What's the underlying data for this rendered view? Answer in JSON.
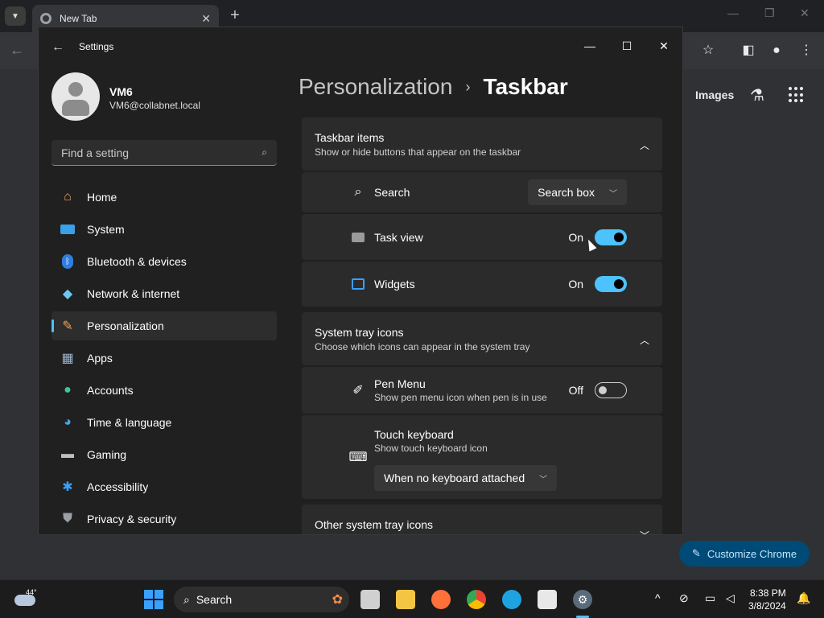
{
  "chrome": {
    "tab_title": "New Tab",
    "images_link": "Images",
    "customize_label": "Customize Chrome"
  },
  "settings": {
    "window_title": "Settings",
    "user": {
      "name": "VM6",
      "email": "VM6@collabnet.local"
    },
    "search_placeholder": "Find a setting",
    "nav": [
      {
        "label": "Home",
        "icon": "home-icon"
      },
      {
        "label": "System",
        "icon": "system-icon"
      },
      {
        "label": "Bluetooth & devices",
        "icon": "bluetooth-icon"
      },
      {
        "label": "Network & internet",
        "icon": "network-icon"
      },
      {
        "label": "Personalization",
        "icon": "brush-icon",
        "active": true
      },
      {
        "label": "Apps",
        "icon": "apps-icon"
      },
      {
        "label": "Accounts",
        "icon": "accounts-icon"
      },
      {
        "label": "Time & language",
        "icon": "globe-icon"
      },
      {
        "label": "Gaming",
        "icon": "gamepad-icon"
      },
      {
        "label": "Accessibility",
        "icon": "accessibility-icon"
      },
      {
        "label": "Privacy & security",
        "icon": "shield-icon"
      }
    ],
    "breadcrumb": {
      "parent": "Personalization",
      "current": "Taskbar"
    },
    "taskbar_items": {
      "title": "Taskbar items",
      "subtitle": "Show or hide buttons that appear on the taskbar",
      "search": {
        "label": "Search",
        "value": "Search box"
      },
      "task_view": {
        "label": "Task view",
        "state": "On"
      },
      "widgets": {
        "label": "Widgets",
        "state": "On"
      }
    },
    "system_tray": {
      "title": "System tray icons",
      "subtitle": "Choose which icons can appear in the system tray",
      "pen_menu": {
        "label": "Pen Menu",
        "sub": "Show pen menu icon when pen is in use",
        "state": "Off"
      },
      "touch_keyboard": {
        "label": "Touch keyboard",
        "sub": "Show touch keyboard icon",
        "value": "When no keyboard attached"
      }
    },
    "other_tray": {
      "title": "Other system tray icons"
    }
  },
  "taskbar": {
    "temperature": "44°",
    "search_label": "Search",
    "time": "8:38 PM",
    "date": "3/8/2024"
  },
  "colors": {
    "accent": "#4cc2ff",
    "window_bg": "#202020",
    "card_bg": "#2b2b2b"
  }
}
